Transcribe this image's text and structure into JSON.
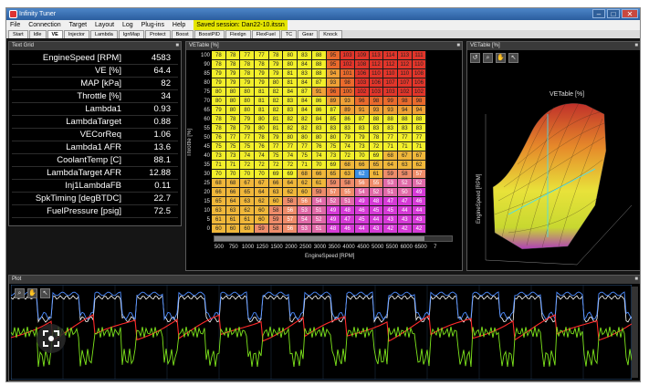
{
  "window": {
    "title": "Infinity Tuner"
  },
  "menu": {
    "items": [
      "File",
      "Connection",
      "Target",
      "Layout",
      "Log",
      "Plug-ins",
      "Help"
    ],
    "session": "Saved session: Dan22-10.itssn"
  },
  "tabs": [
    "Start",
    "Idle",
    "VE",
    "Injector",
    "Lambda",
    "IgnMap",
    "Protect",
    "Boost",
    "BoostPID",
    "Flexlgn",
    "FlexFuel",
    "TC",
    "Gear",
    "Knock"
  ],
  "active_tab": 2,
  "text_grid": {
    "title": "Text Grid",
    "rows": [
      {
        "label": "EngineSpeed [RPM]",
        "value": "4583"
      },
      {
        "label": "VE [%]",
        "value": "64.4"
      },
      {
        "label": "MAP [kPa]",
        "value": "82"
      },
      {
        "label": "Throttle [%]",
        "value": "34"
      },
      {
        "label": "Lambda1",
        "value": "0.93"
      },
      {
        "label": "LambdaTarget",
        "value": "0.88"
      },
      {
        "label": "VECorReq",
        "value": "1.06"
      },
      {
        "label": "Lambda1 AFR",
        "value": "13.6"
      },
      {
        "label": "CoolantTemp [C]",
        "value": "88.1"
      },
      {
        "label": "LambdaTarget AFR",
        "value": "12.88"
      },
      {
        "label": "Inj1LambdaFB",
        "value": "0.11"
      },
      {
        "label": "SpkTiming [degBTDC]",
        "value": "22.7"
      },
      {
        "label": "FuelPressure [psig]",
        "value": "72.5"
      }
    ]
  },
  "ve_table": {
    "title": "VETable [%]",
    "ylabel": "Throttle [%]",
    "xlabel": "EngineSpeed [RPM]",
    "y_axis": [
      "100",
      "90",
      "85",
      "80",
      "75",
      "70",
      "65",
      "60",
      "55",
      "50",
      "45",
      "40",
      "35",
      "30",
      "25",
      "20",
      "15",
      "10",
      "5",
      "0"
    ],
    "x_axis": [
      "500",
      "750",
      "1000",
      "1250",
      "1500",
      "2000",
      "2500",
      "3000",
      "3500",
      "4000",
      "4500",
      "5000",
      "5500",
      "6000",
      "6500",
      "7"
    ],
    "selected": [
      13,
      10
    ],
    "rows": [
      [
        "78",
        "78",
        "77",
        "77",
        "78",
        "80",
        "83",
        "88",
        "95",
        "103",
        "109",
        "113",
        "114",
        "113",
        "111"
      ],
      [
        "78",
        "78",
        "78",
        "78",
        "79",
        "80",
        "84",
        "88",
        "95",
        "102",
        "108",
        "112",
        "112",
        "112",
        "110"
      ],
      [
        "79",
        "79",
        "78",
        "79",
        "79",
        "81",
        "83",
        "88",
        "94",
        "101",
        "106",
        "110",
        "110",
        "110",
        "108"
      ],
      [
        "79",
        "79",
        "79",
        "79",
        "80",
        "81",
        "84",
        "87",
        "93",
        "98",
        "103",
        "106",
        "107",
        "107",
        "106"
      ],
      [
        "80",
        "80",
        "80",
        "81",
        "82",
        "84",
        "87",
        "91",
        "96",
        "100",
        "102",
        "103",
        "103",
        "102",
        "102"
      ],
      [
        "80",
        "80",
        "80",
        "81",
        "82",
        "83",
        "84",
        "86",
        "89",
        "93",
        "96",
        "98",
        "99",
        "98",
        "98"
      ],
      [
        "79",
        "80",
        "80",
        "81",
        "82",
        "83",
        "84",
        "86",
        "87",
        "89",
        "91",
        "93",
        "93",
        "94",
        "94"
      ],
      [
        "78",
        "78",
        "79",
        "80",
        "81",
        "82",
        "82",
        "84",
        "85",
        "86",
        "87",
        "88",
        "88",
        "88",
        "88"
      ],
      [
        "78",
        "78",
        "79",
        "80",
        "81",
        "82",
        "82",
        "83",
        "83",
        "83",
        "83",
        "83",
        "83",
        "83",
        "83"
      ],
      [
        "76",
        "77",
        "77",
        "78",
        "79",
        "80",
        "80",
        "80",
        "80",
        "79",
        "79",
        "78",
        "77",
        "77",
        "77"
      ],
      [
        "75",
        "75",
        "75",
        "76",
        "77",
        "77",
        "77",
        "76",
        "75",
        "74",
        "73",
        "72",
        "71",
        "71",
        "71"
      ],
      [
        "73",
        "73",
        "74",
        "74",
        "75",
        "74",
        "75",
        "74",
        "73",
        "72",
        "70",
        "69",
        "68",
        "67",
        "67"
      ],
      [
        "71",
        "71",
        "72",
        "72",
        "72",
        "72",
        "71",
        "70",
        "69",
        "68",
        "66",
        "65",
        "64",
        "63",
        "62"
      ],
      [
        "70",
        "70",
        "70",
        "70",
        "69",
        "69",
        "68",
        "66",
        "65",
        "63",
        "62",
        "61",
        "59",
        "58",
        "57"
      ],
      [
        "68",
        "68",
        "67",
        "67",
        "66",
        "64",
        "62",
        "61",
        "59",
        "58",
        "56",
        "55",
        "53",
        "52",
        "52"
      ],
      [
        "66",
        "66",
        "65",
        "64",
        "63",
        "62",
        "60",
        "59",
        "57",
        "55",
        "54",
        "52",
        "51",
        "50",
        "49"
      ],
      [
        "65",
        "64",
        "63",
        "62",
        "60",
        "58",
        "56",
        "54",
        "52",
        "51",
        "49",
        "48",
        "47",
        "47",
        "46"
      ],
      [
        "63",
        "63",
        "62",
        "60",
        "58",
        "56",
        "53",
        "51",
        "49",
        "48",
        "46",
        "45",
        "45",
        "44",
        "44"
      ],
      [
        "61",
        "61",
        "61",
        "60",
        "59",
        "57",
        "54",
        "52",
        "49",
        "47",
        "45",
        "44",
        "43",
        "43",
        "43"
      ],
      [
        "60",
        "60",
        "60",
        "59",
        "58",
        "56",
        "53",
        "51",
        "48",
        "46",
        "44",
        "43",
        "42",
        "42",
        "42"
      ]
    ]
  },
  "surface": {
    "title": "VETable [%]",
    "zlabel": "VETable [%]",
    "ylabel": "EngineSpeed [RPM]"
  },
  "plot": {
    "title": "Plot"
  },
  "colors": {
    "yellow": "#f2ef2a",
    "orange": "#f0a136",
    "red": "#e53a25",
    "magenta": "#d53ad6",
    "selection": "#3d8fe3",
    "trace_white": "#ffffff",
    "trace_blue": "#4d8cff",
    "trace_red": "#ff2a2a",
    "trace_green": "#7ee61c"
  }
}
